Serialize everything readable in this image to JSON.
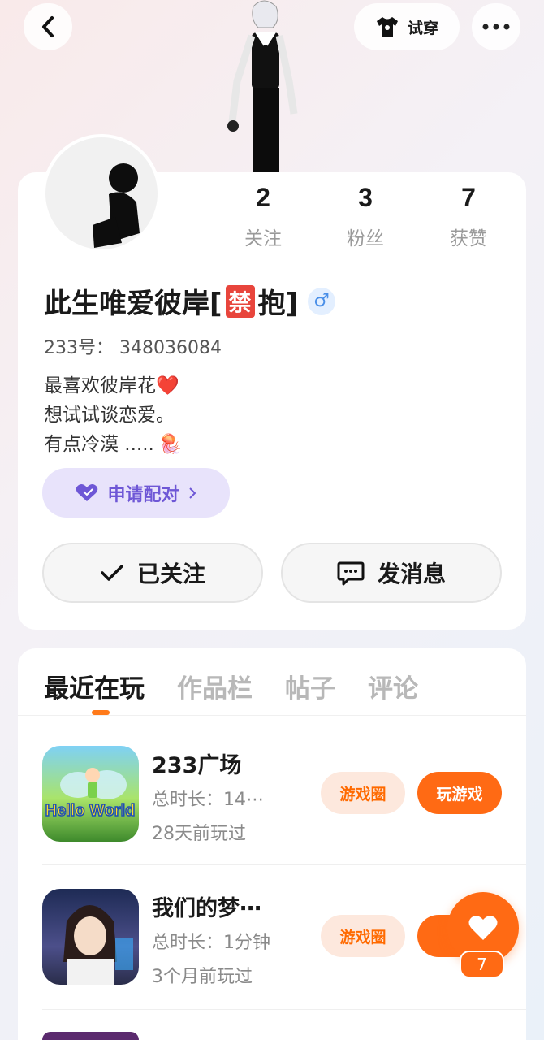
{
  "header": {
    "tryon_label": "试穿"
  },
  "stats": [
    {
      "value": "2",
      "label": "关注"
    },
    {
      "value": "3",
      "label": "粉丝"
    },
    {
      "value": "7",
      "label": "获赞"
    }
  ],
  "profile": {
    "name_prefix": "此生唯爱彼岸[",
    "name_badge": "禁",
    "name_suffix": "抱]",
    "gender_symbol": "♂",
    "uid": "233号： 348036084",
    "bio": [
      "最喜欢彼岸花",
      "想试试谈恋爱。",
      "有点冷漠 ....."
    ],
    "bio_emojis": [
      "❤️",
      "🪼"
    ]
  },
  "pair_button": {
    "label": "申请配对"
  },
  "actions": {
    "follow_label": "已关注",
    "message_label": "发消息"
  },
  "tabs": [
    "最近在玩",
    "作品栏",
    "帖子",
    "评论"
  ],
  "games": [
    {
      "title": "233广场",
      "duration": "总时长：14⋯",
      "last_played": "28天前玩过",
      "icon_text": "Hello World",
      "circle_label": "游戏圈",
      "play_label": "玩游戏"
    },
    {
      "title": "我们的梦⋯",
      "duration": "总时长：1分钟",
      "last_played": "3个月前玩过",
      "circle_label": "游戏圈",
      "play_label": "玩"
    }
  ],
  "like_fab": {
    "count": "7"
  },
  "colors": {
    "accent_orange": "#ff6a14",
    "pair_purple": "#6e57d6",
    "ban_red": "#e8453c"
  }
}
